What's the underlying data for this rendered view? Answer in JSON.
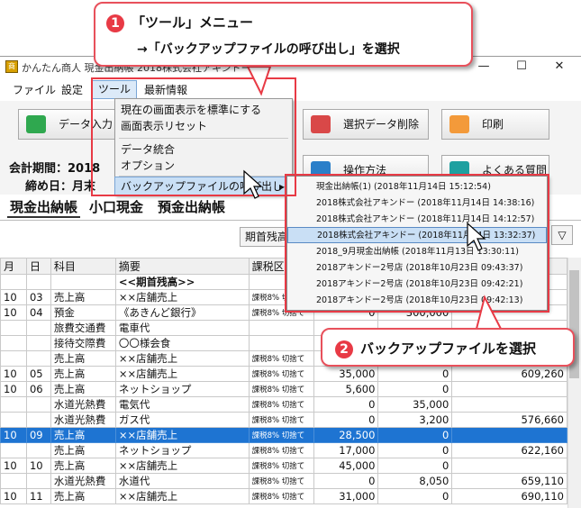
{
  "window": {
    "title": "かんたん商人 現金出納帳 2018株式会社アキンドー",
    "minimize": "—",
    "maximize": "☐",
    "close": "✕"
  },
  "menubar": [
    "ファイル",
    "設定",
    "ツール",
    "最新情報"
  ],
  "toolbar": {
    "data_input": "データ入力",
    "delete_selected": "選択データ削除",
    "print": "印刷",
    "operation": "操作方法",
    "faq": "よくある質問",
    "period_label": "会計期間：2018",
    "closing_label": "締め日：月末"
  },
  "tool_menu": {
    "items": [
      "現在の画面表示を標準にする",
      "画面表示リセット",
      "データ統合",
      "オプション",
      "バックアップファイルの呼び出し"
    ],
    "submenu_arrow": "▸"
  },
  "submenu": {
    "items": [
      "現金出納帳(1) (2018年11月14日 15:12:54)",
      "2018株式会社アキンドー (2018年11月14日 14:38:16)",
      "2018株式会社アキンドー (2018年11月14日 14:12:57)",
      "2018株式会社アキンドー (2018年11月14日 13:32:37)",
      "2018_9月現金出納帳 (2018年11月13日 13:30:11)",
      "2018アキンドー2号店 (2018年10月23日 09:43:37)",
      "2018アキンドー2号店 (2018年10月23日 09:42:21)",
      "2018アキンドー2号店 (2018年10月23日 09:42:13)"
    ],
    "selected_index": 3
  },
  "tabs": [
    "現金出納帳",
    "小口現金",
    "預金出納帳"
  ],
  "filter_button": "期首残高",
  "dropdown_arrow": "▽",
  "table": {
    "headers": [
      "月",
      "日",
      "科目",
      "摘要",
      "課税区",
      "",
      "",
      ""
    ],
    "rows": [
      [
        "",
        "",
        "",
        "<<期首残高>>",
        "",
        "",
        "",
        ""
      ],
      [
        "10",
        "03",
        "売上高",
        "××店舗売上",
        "課税8% 切捨て",
        "",
        "",
        ""
      ],
      [
        "10",
        "04",
        "預金",
        "《あきんど銀行》",
        "課税8% 切捨て",
        "0",
        "300,000",
        ""
      ],
      [
        "",
        "",
        "旅費交通費",
        "電車代",
        "",
        "",
        "",
        ""
      ],
      [
        "",
        "",
        "接待交際費",
        "〇〇様会食",
        "",
        "",
        "",
        ""
      ],
      [
        "",
        "",
        "売上高",
        "××店舗売上",
        "課税8% 切捨て",
        "",
        "",
        ""
      ],
      [
        "10",
        "05",
        "売上高",
        "××店舗売上",
        "課税8% 切捨て",
        "35,000",
        "0",
        "609,260"
      ],
      [
        "10",
        "06",
        "売上高",
        "ネットショップ",
        "課税8% 切捨て",
        "5,600",
        "0",
        ""
      ],
      [
        "",
        "",
        "水道光熱費",
        "電気代",
        "課税8% 切捨て",
        "0",
        "35,000",
        ""
      ],
      [
        "",
        "",
        "水道光熱費",
        "ガス代",
        "課税8% 切捨て",
        "0",
        "3,200",
        "576,660"
      ],
      [
        "10",
        "09",
        "売上高",
        "××店舗売上",
        "課税8% 切捨て",
        "28,500",
        "0",
        ""
      ],
      [
        "",
        "",
        "売上高",
        "ネットショップ",
        "課税8% 切捨て",
        "17,000",
        "0",
        "622,160"
      ],
      [
        "10",
        "10",
        "売上高",
        "××店舗売上",
        "課税8% 切捨て",
        "45,000",
        "0",
        ""
      ],
      [
        "",
        "",
        "水道光熱費",
        "水道代",
        "課税8% 切捨て",
        "0",
        "8,050",
        "659,110"
      ],
      [
        "10",
        "11",
        "売上高",
        "××店舗売上",
        "課税8% 切捨て",
        "31,000",
        "0",
        "690,110"
      ]
    ],
    "selected_row": 10
  },
  "callouts": {
    "step1_num": "1",
    "step1_line1": "「ツール」メニュー",
    "step1_line2": "→「バックアップファイルの呼び出し」を選択",
    "step2_num": "2",
    "step2_text": "バックアップファイルを選択"
  },
  "colors": {
    "accent_red": "#e83a45",
    "selection_blue": "#1e74d2",
    "menu_highlight": "#c9dff5"
  }
}
